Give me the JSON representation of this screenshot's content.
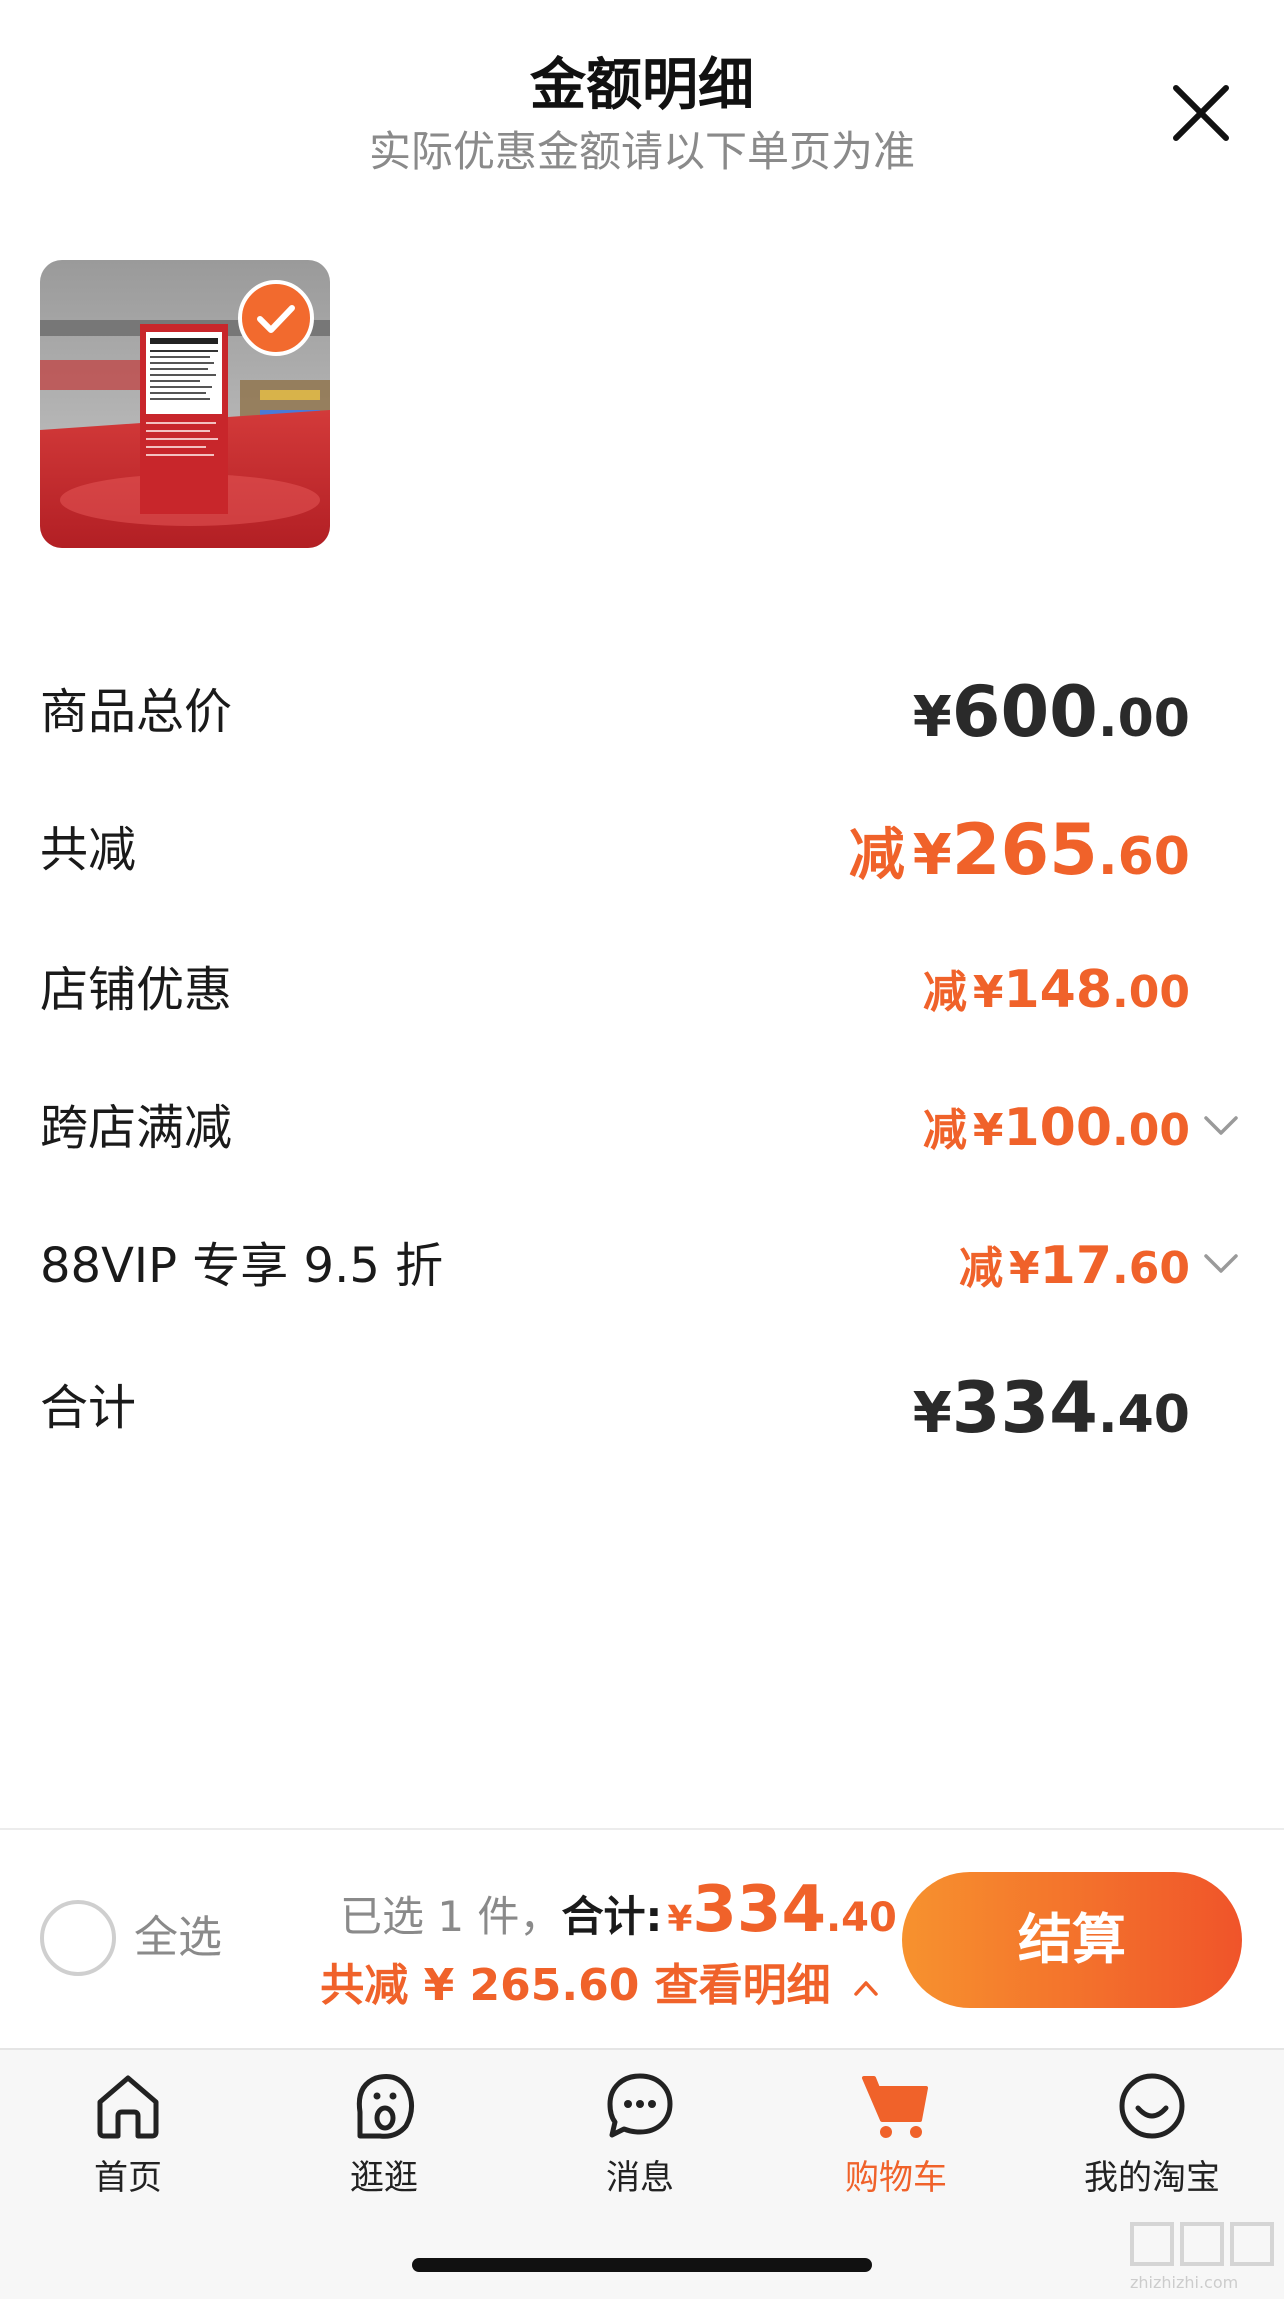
{
  "header": {
    "title": "金额明细",
    "subtitle": "实际优惠金额请以下单页为准"
  },
  "product": {
    "label_text": "Supplement Facts"
  },
  "rows": {
    "subtotal": {
      "label": "商品总价",
      "prefix": "",
      "yen": "¥",
      "int": "600",
      "dec": ".00"
    },
    "total_discount": {
      "label": "共减",
      "prefix": "减",
      "yen": "¥",
      "int": "265",
      "dec": ".60"
    },
    "store_discount": {
      "label": "店铺优惠",
      "prefix": "减",
      "yen": "¥",
      "int": "148",
      "dec": ".00"
    },
    "cross_store": {
      "label": "跨店满减",
      "prefix": "减",
      "yen": "¥",
      "int": "100",
      "dec": ".00"
    },
    "vip": {
      "label": "88VIP 专享 9.5 折",
      "prefix": "减",
      "yen": "¥",
      "int": "17",
      "dec": ".60"
    },
    "total": {
      "label": "合计",
      "prefix": "",
      "yen": "¥",
      "int": "334",
      "dec": ".40"
    }
  },
  "checkout": {
    "select_all": "全选",
    "selected": "已选 1 件，",
    "total_label": "合计:",
    "yen": "¥",
    "int": "334",
    "dec": ".40",
    "discount_text": "共减 ¥ 265.60 查看明细",
    "button": "结算"
  },
  "tabs": [
    {
      "label": "首页",
      "icon": "home-icon"
    },
    {
      "label": "逛逛",
      "icon": "browse-icon"
    },
    {
      "label": "消息",
      "icon": "message-icon"
    },
    {
      "label": "购物车",
      "icon": "cart-icon"
    },
    {
      "label": "我的淘宝",
      "icon": "profile-icon"
    }
  ],
  "colors": {
    "accent": "#f0622a",
    "button_start": "#f7922e",
    "button_end": "#f0542a",
    "text": "#1a1a1a",
    "muted": "#8a8a8a"
  },
  "watermark": {
    "text": "zhizhizhi.com"
  }
}
